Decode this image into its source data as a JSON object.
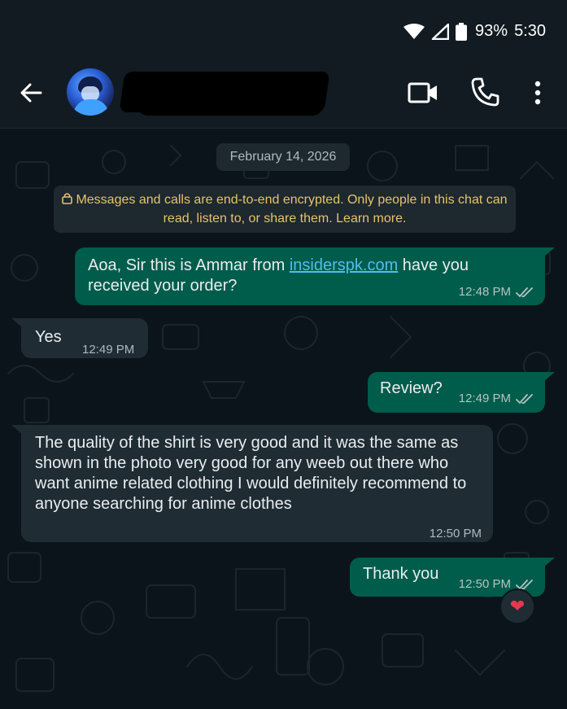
{
  "status_bar": {
    "battery": "93%",
    "time": "5:30"
  },
  "header": {
    "contact_name": ""
  },
  "date_chip": "February 14, 2026",
  "encryption_notice": "Messages and calls are end-to-end encrypted. Only people in this chat can read, listen to, or share them. Learn more.",
  "messages": [
    {
      "direction": "outgoing",
      "text_before": "Aoa, Sir this is Ammar from ",
      "link": "insiderspk.com",
      "text_after": " have you received your order?",
      "time": "12:48 PM",
      "status": "read"
    },
    {
      "direction": "incoming",
      "text": "Yes",
      "time": "12:49 PM"
    },
    {
      "direction": "outgoing",
      "text": "Review?",
      "time": "12:49 PM",
      "status": "read"
    },
    {
      "direction": "incoming",
      "text": "The quality of the shirt is very good and it was the same as shown in the photo very good for any weeb out there who want anime related clothing I would definitely recommend to anyone searching for anime clothes",
      "time": "12:50 PM"
    },
    {
      "direction": "outgoing",
      "text": "Thank you",
      "time": "12:50 PM",
      "status": "read",
      "reaction": "❤"
    }
  ],
  "colors": {
    "outgoing_bubble": "#005c4b",
    "incoming_bubble": "#1f2c34",
    "background": "#0b141a",
    "link": "#53bdeb",
    "notice_text": "#e6c46a"
  }
}
